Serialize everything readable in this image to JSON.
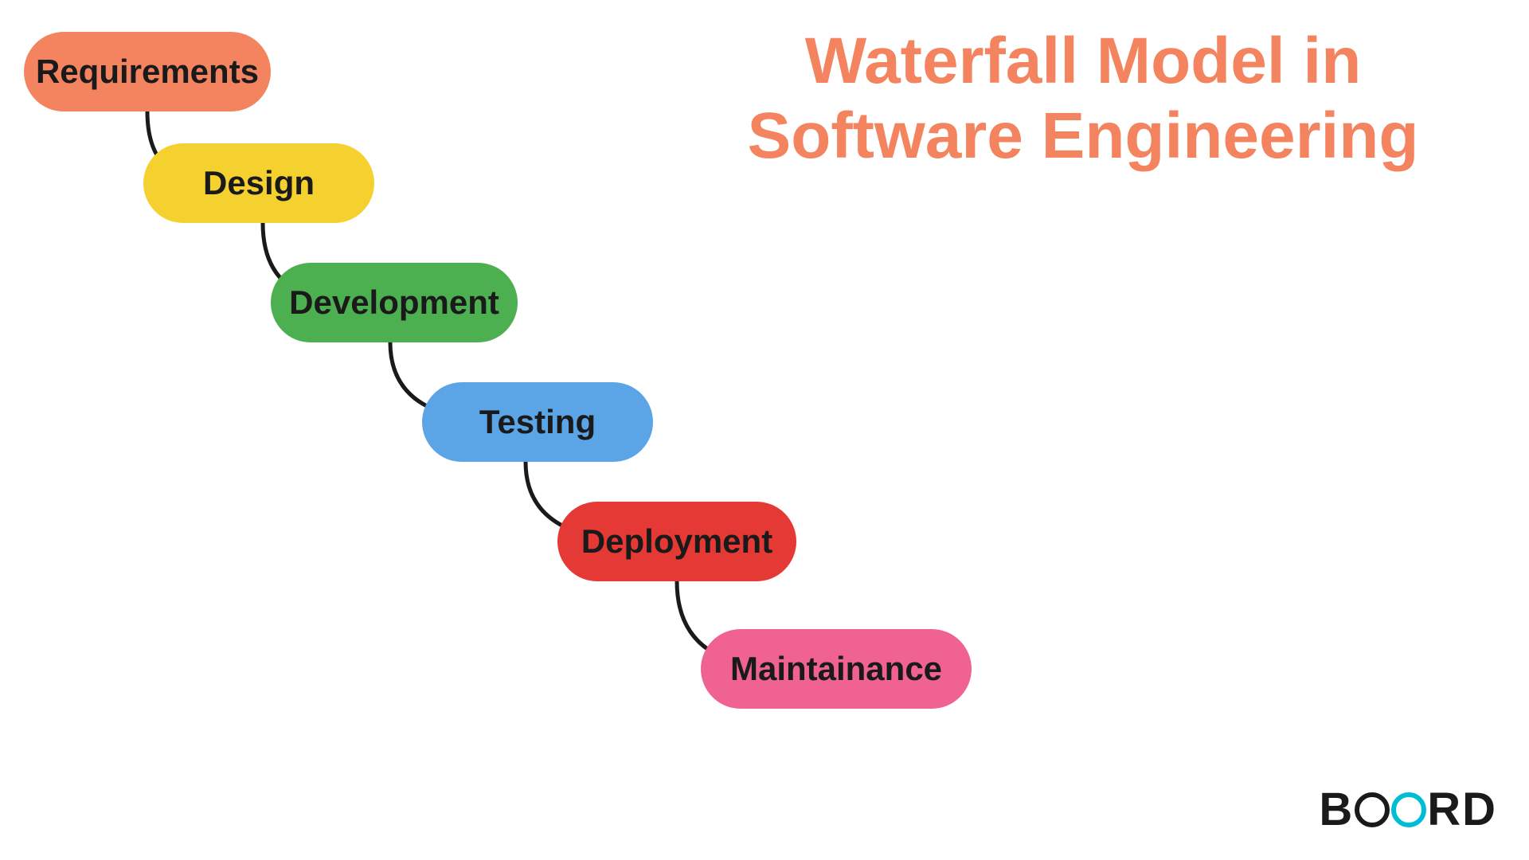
{
  "title": {
    "line1": "Waterfall Model in",
    "line2": "Software Engineering"
  },
  "steps": [
    {
      "id": "requirements",
      "label": "Requirements",
      "color": "#F4845F",
      "textColor": "#1a1a1a"
    },
    {
      "id": "design",
      "label": "Design",
      "color": "#F5D130",
      "textColor": "#1a1a1a"
    },
    {
      "id": "development",
      "label": "Development",
      "color": "#4CAF50",
      "textColor": "#1a1a1a"
    },
    {
      "id": "testing",
      "label": "Testing",
      "color": "#5BA4E5",
      "textColor": "#1a1a1a"
    },
    {
      "id": "deployment",
      "label": "Deployment",
      "color": "#E53935",
      "textColor": "#1a1a1a"
    },
    {
      "id": "maintainance",
      "label": "Maintainance",
      "color": "#F06292",
      "textColor": "#1a1a1a"
    }
  ],
  "logo": {
    "text": "BOARD"
  }
}
